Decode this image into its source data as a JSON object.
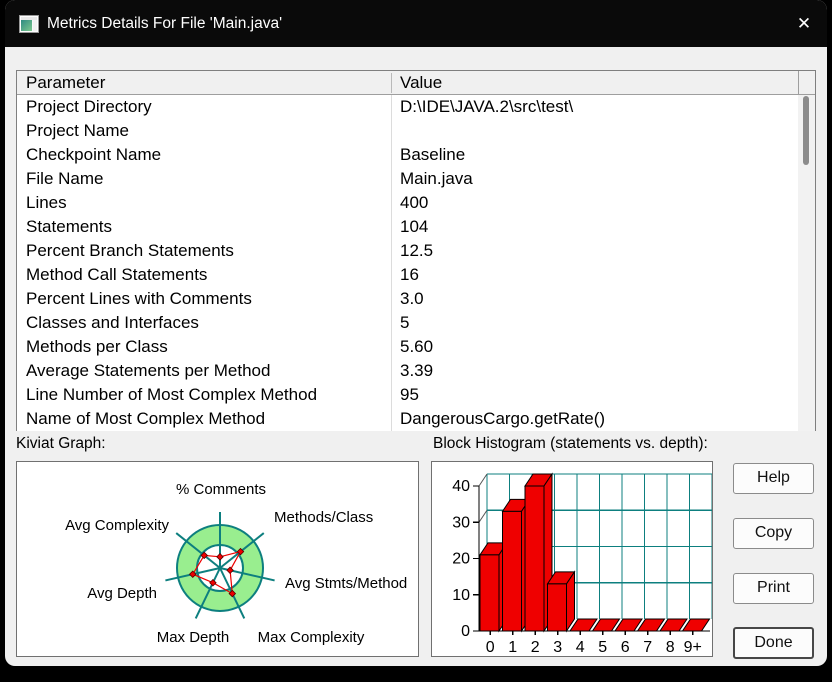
{
  "window": {
    "title": "Metrics Details For File 'Main.java'"
  },
  "titlebar": {
    "close_glyph": "✕"
  },
  "table": {
    "columns": [
      "Parameter",
      "Value"
    ],
    "rows": [
      {
        "param": "Project Directory",
        "value": "D:\\IDE\\JAVA.2\\src\\test\\"
      },
      {
        "param": "Project Name",
        "value": ""
      },
      {
        "param": "Checkpoint Name",
        "value": "Baseline"
      },
      {
        "param": "File Name",
        "value": "Main.java"
      },
      {
        "param": "Lines",
        "value": "400"
      },
      {
        "param": "Statements",
        "value": "104"
      },
      {
        "param": "Percent Branch Statements",
        "value": "12.5"
      },
      {
        "param": "Method Call Statements",
        "value": "16"
      },
      {
        "param": "Percent Lines with Comments",
        "value": "3.0"
      },
      {
        "param": "Classes and Interfaces",
        "value": "5"
      },
      {
        "param": "Methods per Class",
        "value": "5.60"
      },
      {
        "param": "Average Statements per Method",
        "value": "3.39"
      },
      {
        "param": "Line Number of Most Complex Method",
        "value": "95"
      },
      {
        "param": "Name of Most Complex Method",
        "value": "DangerousCargo.getRate()"
      }
    ]
  },
  "sections": {
    "kiviat_label": "Kiviat Graph:",
    "histogram_label": "Block Histogram (statements vs. depth):"
  },
  "buttons": {
    "help": "Help",
    "copy": "Copy",
    "print": "Print",
    "done": "Done"
  },
  "chart_data": [
    {
      "type": "radar",
      "title": "Kiviat Graph",
      "axes": [
        "% Comments",
        "Methods/Class",
        "Avg Stmts/Method",
        "Max Complexity",
        "Max Depth",
        "Avg Depth",
        "Avg Complexity"
      ],
      "values_fraction_of_outer": [
        0.26,
        0.61,
        0.24,
        0.66,
        0.38,
        0.65,
        0.47
      ],
      "ring_inner_fraction": 0.535,
      "legend_position": "none",
      "colors": {
        "band": "#99ee8f",
        "axis": "#0d7f7f",
        "data": "#ee0000"
      }
    },
    {
      "type": "bar",
      "title": "Block Histogram (statements vs. depth)",
      "categories": [
        "0",
        "1",
        "2",
        "3",
        "4",
        "5",
        "6",
        "7",
        "8",
        "9+"
      ],
      "values": [
        21,
        33,
        40,
        13,
        0,
        0,
        0,
        0,
        0,
        0
      ],
      "xlabel": "depth",
      "ylabel": "statements",
      "ylim": [
        0,
        40
      ],
      "yticks": [
        0,
        10,
        20,
        30,
        40
      ],
      "grid": true,
      "style": "3d",
      "colors": {
        "bar": "#ef0000",
        "grid": "#0d7f7f",
        "axis": "#000000"
      }
    }
  ]
}
